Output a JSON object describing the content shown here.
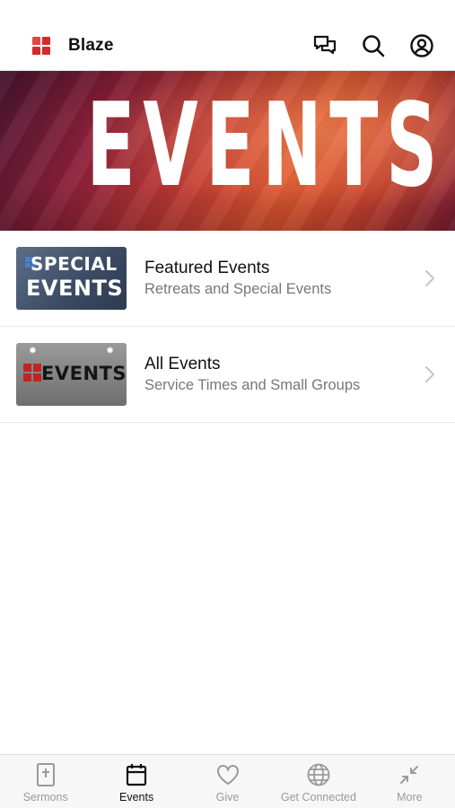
{
  "header": {
    "app_title": "Blaze",
    "icons": [
      "chat-icon",
      "search-icon",
      "profile-icon"
    ],
    "logo_color": "#d42a2a"
  },
  "banner": {
    "text": "EVENTS"
  },
  "list": [
    {
      "title": "Featured Events",
      "subtitle": "Retreats and Special Events",
      "thumb_line1": "SPECIAL",
      "thumb_line2": "EVENTS"
    },
    {
      "title": "All Events",
      "subtitle": "Service Times and Small Groups",
      "thumb_line1": "EVENTS"
    }
  ],
  "tabs": [
    {
      "label": "Sermons",
      "icon": "bible-icon"
    },
    {
      "label": "Events",
      "icon": "calendar-icon",
      "active": true
    },
    {
      "label": "Give",
      "icon": "heart-icon"
    },
    {
      "label": "Get Connected",
      "icon": "globe-icon"
    },
    {
      "label": "More",
      "icon": "collapse-arrows-icon"
    }
  ],
  "colors": {
    "active_tab": "#111111",
    "inactive_tab": "#9a9a9a",
    "subtitle": "#777777"
  }
}
